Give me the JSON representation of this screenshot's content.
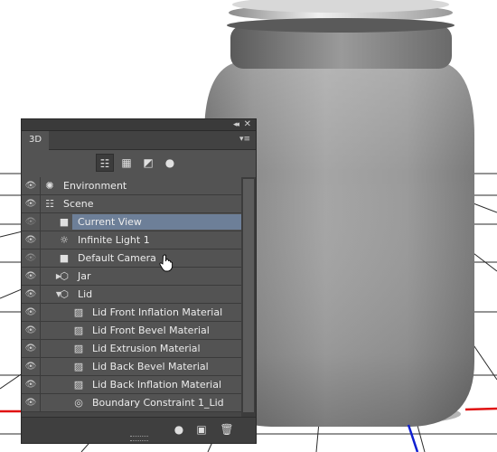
{
  "panel": {
    "tab_label": "3D",
    "collapse_glyph": "◂◂",
    "close_glyph": "✕",
    "menu_glyph": "▾≡"
  },
  "filters": [
    {
      "icon": "whole-scene-icon",
      "glyph": "☷",
      "active": true
    },
    {
      "icon": "meshes-icon",
      "glyph": "▦",
      "active": false
    },
    {
      "icon": "materials-icon",
      "glyph": "◩",
      "active": false
    },
    {
      "icon": "lights-icon",
      "glyph": "●",
      "active": false
    }
  ],
  "layers": [
    {
      "label": "Environment",
      "icon": "environment-icon",
      "glyph": "✺",
      "twirl": "",
      "dim": false,
      "selected": false
    },
    {
      "label": "Scene",
      "icon": "scene-icon",
      "glyph": "☷",
      "twirl": "",
      "dim": false,
      "selected": false
    },
    {
      "label": "Current View",
      "icon": "camera-icon",
      "glyph": "■",
      "twirl": "",
      "dim": true,
      "selected": true
    },
    {
      "label": "Infinite Light 1",
      "icon": "infinite-light-icon",
      "glyph": "☼",
      "twirl": "",
      "dim": false,
      "selected": false
    },
    {
      "label": "Default Camera",
      "icon": "camera-icon",
      "glyph": "■",
      "twirl": "",
      "dim": true,
      "selected": false
    },
    {
      "label": "Jar",
      "icon": "mesh-icon",
      "glyph": "⬡",
      "twirl": "▶",
      "dim": false,
      "selected": false
    },
    {
      "label": "Lid",
      "icon": "mesh-icon",
      "glyph": "⬡",
      "twirl": "▼",
      "dim": false,
      "selected": false
    },
    {
      "label": "Lid Front Inflation Material",
      "icon": "material-icon",
      "glyph": "▨",
      "twirl": "",
      "dim": false,
      "selected": false
    },
    {
      "label": "Lid Front Bevel Material",
      "icon": "material-icon",
      "glyph": "▨",
      "twirl": "",
      "dim": false,
      "selected": false
    },
    {
      "label": "Lid Extrusion Material",
      "icon": "material-icon",
      "glyph": "▨",
      "twirl": "",
      "dim": false,
      "selected": false
    },
    {
      "label": "Lid Back Bevel Material",
      "icon": "material-icon",
      "glyph": "▨",
      "twirl": "",
      "dim": false,
      "selected": false
    },
    {
      "label": "Lid Back Inflation Material",
      "icon": "material-icon",
      "glyph": "▨",
      "twirl": "",
      "dim": false,
      "selected": false
    },
    {
      "label": "Boundary Constraint 1_Lid",
      "icon": "constraint-icon",
      "glyph": "◎",
      "twirl": "",
      "dim": false,
      "selected": false
    }
  ],
  "bottom_buttons": [
    {
      "icon": "add-light-icon",
      "glyph": "●"
    },
    {
      "icon": "render-icon",
      "glyph": "▣"
    },
    {
      "icon": "trash-icon",
      "glyph": "🗑"
    }
  ],
  "colors": {
    "panel_bg": "#535353",
    "selection": "#6d7f98",
    "axis_x": "#e01010",
    "axis_z": "#1020d0"
  }
}
